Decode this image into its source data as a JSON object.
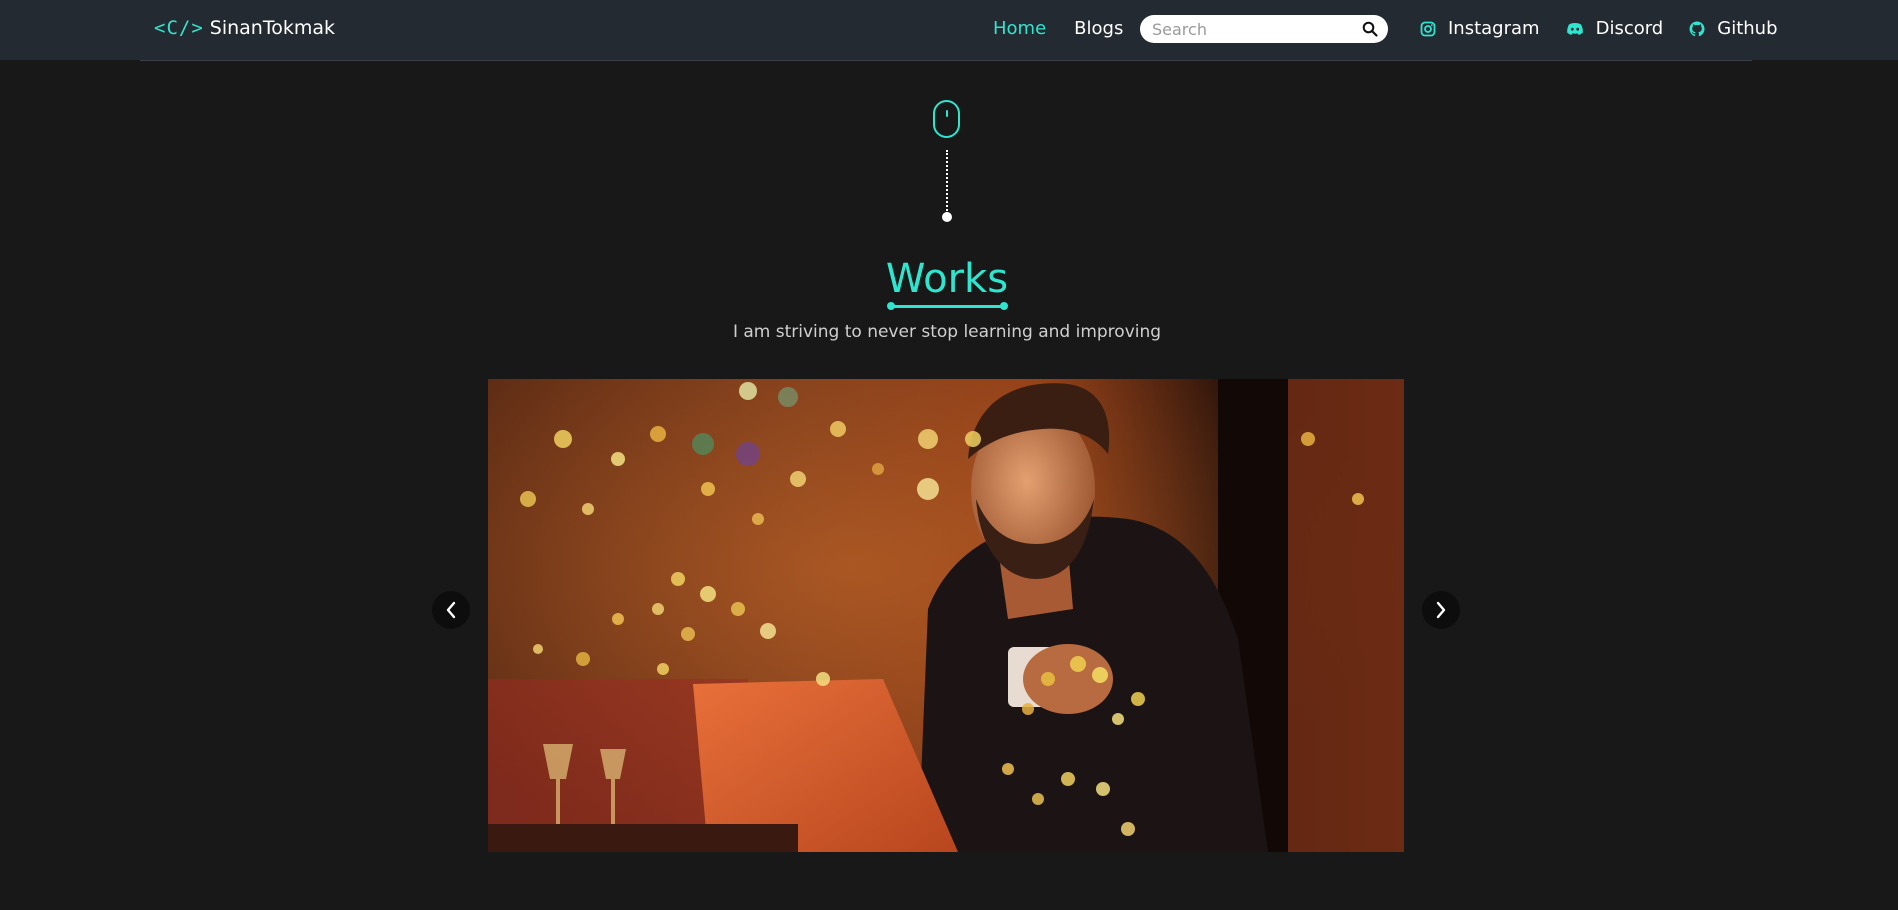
{
  "brand": {
    "code": "<C/>",
    "name": "SinanTokmak"
  },
  "nav": {
    "links": [
      {
        "label": "Home",
        "active": true
      },
      {
        "label": "Blogs",
        "active": false
      }
    ]
  },
  "search": {
    "placeholder": "Search",
    "value": ""
  },
  "socials": [
    {
      "label": "Instagram",
      "icon": "instagram-icon"
    },
    {
      "label": "Discord",
      "icon": "discord-icon"
    },
    {
      "label": "Github",
      "icon": "github-icon"
    }
  ],
  "section": {
    "title": "Works",
    "subtitle": "I am striving to never stop learning and improving"
  },
  "carousel": {
    "prev_icon": "chevron-left-icon",
    "next_icon": "chevron-right-icon"
  },
  "colors": {
    "accent": "#2ee6cf",
    "background": "#181818",
    "navbar": "#242a32"
  }
}
